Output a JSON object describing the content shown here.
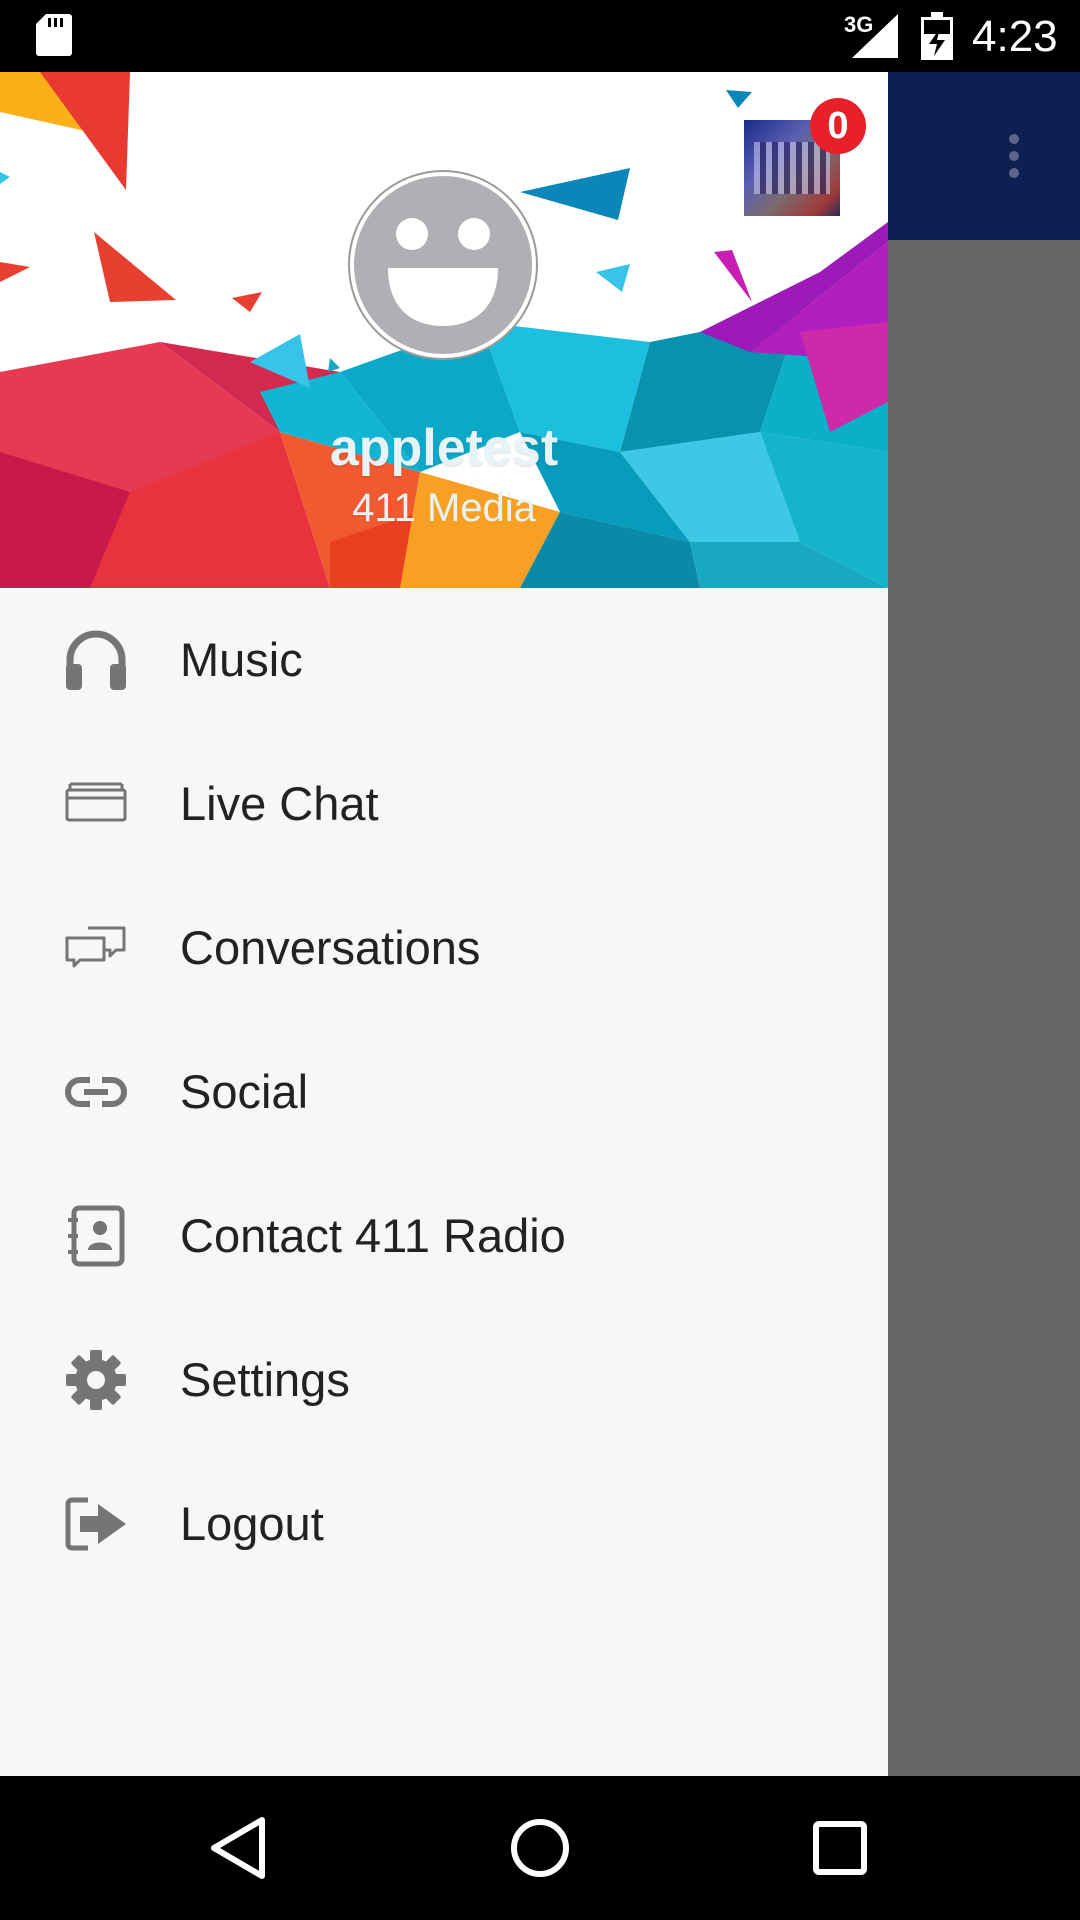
{
  "status_bar": {
    "network": "3G",
    "time": "4:23"
  },
  "drawer": {
    "header": {
      "user_name": "appletest",
      "subtitle": "411 Media",
      "notification_count": "0"
    },
    "menu": [
      {
        "label": "Music",
        "icon": "headphones-icon"
      },
      {
        "label": "Live Chat",
        "icon": "chat-window-icon"
      },
      {
        "label": "Conversations",
        "icon": "conversations-icon"
      },
      {
        "label": "Social",
        "icon": "link-icon"
      },
      {
        "label": "Contact 411 Radio",
        "icon": "contact-book-icon"
      },
      {
        "label": "Settings",
        "icon": "gear-icon"
      },
      {
        "label": "Logout",
        "icon": "logout-icon"
      }
    ]
  },
  "colors": {
    "toolbar": "#0e1f52",
    "scrim": "#666666",
    "drawer_bg": "#f7f7f7",
    "icon": "#757575",
    "badge": "#e8202a"
  }
}
